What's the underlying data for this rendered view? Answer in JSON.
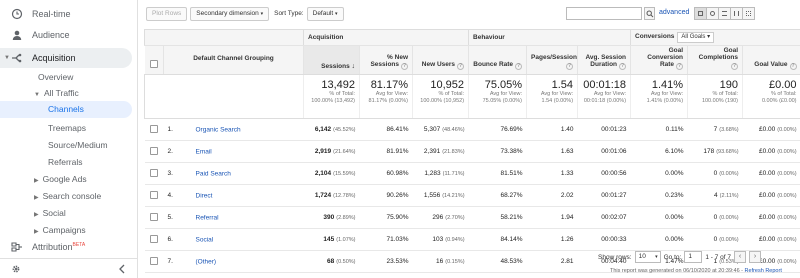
{
  "sidebar": {
    "realtime": "Real-time",
    "audience": "Audience",
    "acquisition": "Acquisition",
    "overview": "Overview",
    "all_traffic": "All Traffic",
    "channels": "Channels",
    "treemaps": "Treemaps",
    "source_medium": "Source/Medium",
    "referrals": "Referrals",
    "google_ads": "Google Ads",
    "search_console": "Search console",
    "social": "Social",
    "campaigns": "Campaigns",
    "attribution": "Attribution",
    "attribution_badge": "BETA"
  },
  "toolbar": {
    "plot_rows": "Plot Rows",
    "secondary_dimension": "Secondary dimension",
    "sort_type_label": "Sort Type:",
    "sort_type_value": "Default",
    "search_value": "",
    "advanced": "advanced"
  },
  "table": {
    "group_acquisition": "Acquisition",
    "group_behaviour": "Behaviour",
    "group_conversions": "Conversions",
    "conversions_select": "All Goals",
    "dimension_header": "Default Channel Grouping",
    "columns": [
      "Sessions",
      "% New Sessions",
      "New Users",
      "Bounce Rate",
      "Pages/Session",
      "Avg. Session Duration",
      "Goal Conversion Rate",
      "Goal Completions",
      "Goal Value"
    ],
    "totals": [
      {
        "big": "13,492",
        "l1": "% of Total:",
        "l2": "100.00% (13,492)"
      },
      {
        "big": "81.17%",
        "l1": "Avg for View:",
        "l2": "81.17% (0.00%)"
      },
      {
        "big": "10,952",
        "l1": "% of Total:",
        "l2": "100.00% (10,952)"
      },
      {
        "big": "75.05%",
        "l1": "Avg for View:",
        "l2": "75.05% (0.00%)"
      },
      {
        "big": "1.54",
        "l1": "Avg for View:",
        "l2": "1.54 (0.00%)"
      },
      {
        "big": "00:01:18",
        "l1": "Avg for View:",
        "l2": "00:01:18 (0.00%)"
      },
      {
        "big": "1.41%",
        "l1": "Avg for View:",
        "l2": "1.41% (0.00%)"
      },
      {
        "big": "190",
        "l1": "% of Total:",
        "l2": "100.00% (190)"
      },
      {
        "big": "£0.00",
        "l1": "% of Total:",
        "l2": "0.00% (£0.00)"
      }
    ],
    "rows": [
      {
        "n": "1.",
        "channel": "Organic Search",
        "sessions": "6,142",
        "sessions_pct": "(45.52%)",
        "new_sessions": "86.41%",
        "new_users": "5,307",
        "new_users_pct": "(48.46%)",
        "bounce": "76.69%",
        "pages": "1.40",
        "duration": "00:01:23",
        "conv_rate": "0.11%",
        "completions": "7",
        "completions_pct": "(3.68%)",
        "value": "£0.00",
        "value_pct": "(0.00%)"
      },
      {
        "n": "2.",
        "channel": "Email",
        "sessions": "2,919",
        "sessions_pct": "(21.64%)",
        "new_sessions": "81.91%",
        "new_users": "2,391",
        "new_users_pct": "(21.83%)",
        "bounce": "73.38%",
        "pages": "1.63",
        "duration": "00:01:06",
        "conv_rate": "6.10%",
        "completions": "178",
        "completions_pct": "(93.68%)",
        "value": "£0.00",
        "value_pct": "(0.00%)"
      },
      {
        "n": "3.",
        "channel": "Paid Search",
        "sessions": "2,104",
        "sessions_pct": "(15.59%)",
        "new_sessions": "60.98%",
        "new_users": "1,283",
        "new_users_pct": "(11.71%)",
        "bounce": "81.51%",
        "pages": "1.33",
        "duration": "00:00:56",
        "conv_rate": "0.00%",
        "completions": "0",
        "completions_pct": "(0.00%)",
        "value": "£0.00",
        "value_pct": "(0.00%)"
      },
      {
        "n": "4.",
        "channel": "Direct",
        "sessions": "1,724",
        "sessions_pct": "(12.78%)",
        "new_sessions": "90.26%",
        "new_users": "1,556",
        "new_users_pct": "(14.21%)",
        "bounce": "68.27%",
        "pages": "2.02",
        "duration": "00:01:27",
        "conv_rate": "0.23%",
        "completions": "4",
        "completions_pct": "(2.11%)",
        "value": "£0.00",
        "value_pct": "(0.00%)"
      },
      {
        "n": "5.",
        "channel": "Referral",
        "sessions": "390",
        "sessions_pct": "(2.89%)",
        "new_sessions": "75.90%",
        "new_users": "296",
        "new_users_pct": "(2.70%)",
        "bounce": "58.21%",
        "pages": "1.94",
        "duration": "00:02:07",
        "conv_rate": "0.00%",
        "completions": "0",
        "completions_pct": "(0.00%)",
        "value": "£0.00",
        "value_pct": "(0.00%)"
      },
      {
        "n": "6.",
        "channel": "Social",
        "sessions": "145",
        "sessions_pct": "(1.07%)",
        "new_sessions": "71.03%",
        "new_users": "103",
        "new_users_pct": "(0.94%)",
        "bounce": "84.14%",
        "pages": "1.26",
        "duration": "00:00:33",
        "conv_rate": "0.00%",
        "completions": "0",
        "completions_pct": "(0.00%)",
        "value": "£0.00",
        "value_pct": "(0.00%)"
      },
      {
        "n": "7.",
        "channel": "(Other)",
        "sessions": "68",
        "sessions_pct": "(0.50%)",
        "new_sessions": "23.53%",
        "new_users": "16",
        "new_users_pct": "(0.15%)",
        "bounce": "48.53%",
        "pages": "2.81",
        "duration": "00:04:40",
        "conv_rate": "1.47%",
        "completions": "1",
        "completions_pct": "(0.53%)",
        "value": "£0.00",
        "value_pct": "(0.00%)"
      }
    ]
  },
  "footer": {
    "show_rows_label": "Show rows:",
    "show_rows_value": "10",
    "goto_label": "Go to:",
    "goto_value": "1",
    "range": "1 - 7 of 7",
    "report_note": "This report was generated on 06/10/2020 at 20:39:46 -",
    "refresh": "Refresh Report"
  },
  "colors": {
    "link": "#1a55b5",
    "active_nav_bg": "#e8f0fe",
    "active_nav_text": "#1a73e8",
    "acquisition_bg": "#eceff1"
  }
}
